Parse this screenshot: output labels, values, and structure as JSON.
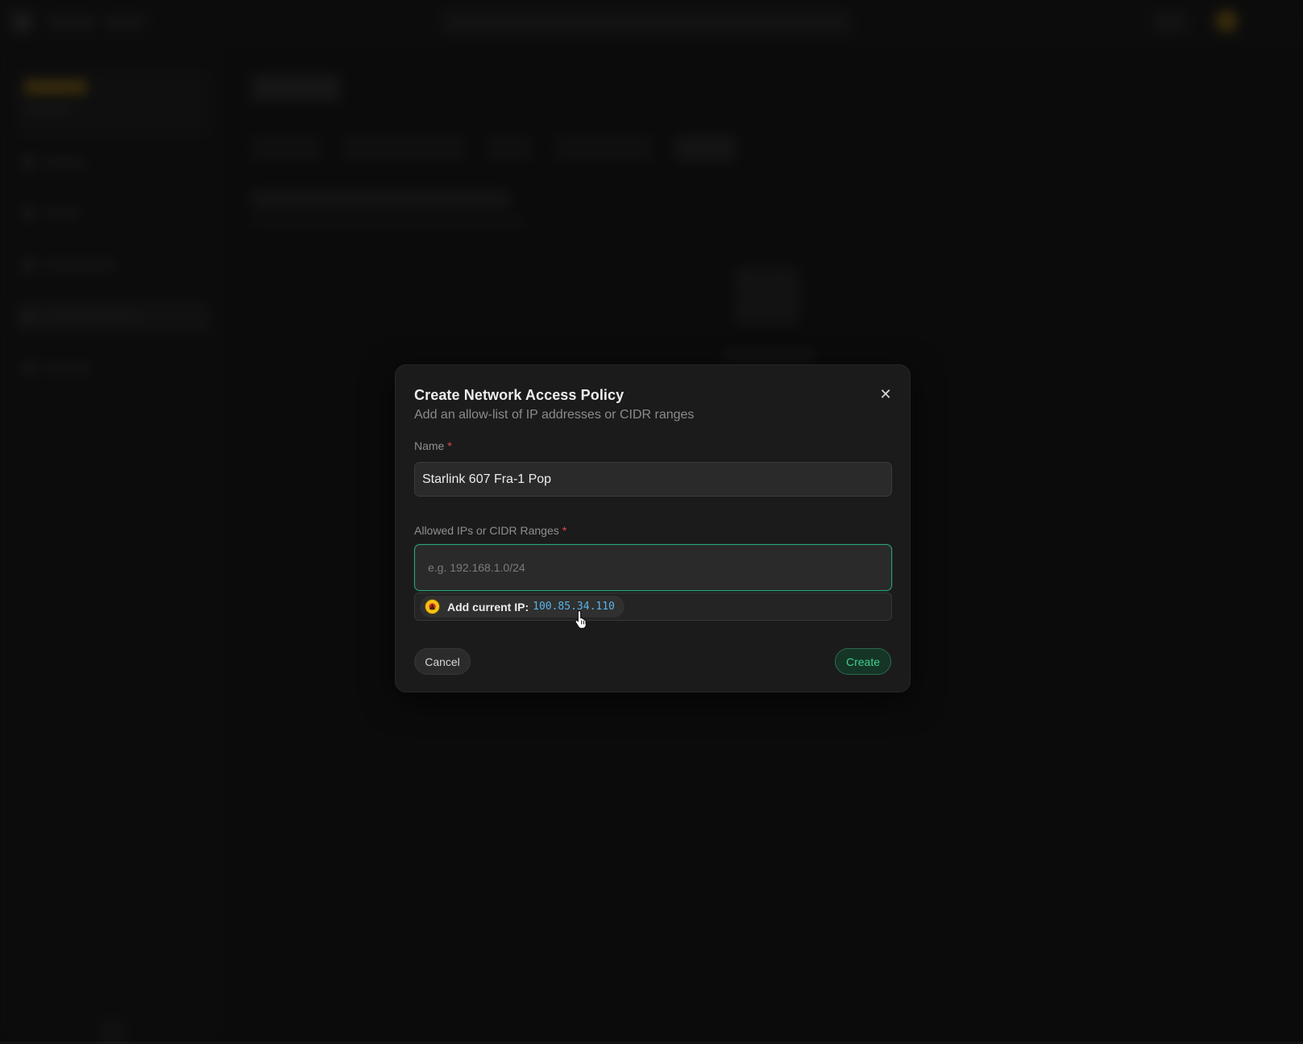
{
  "modal": {
    "title": "Create Network Access Policy",
    "description": "Add an allow-list of IP addresses or CIDR ranges",
    "close_icon": "close-icon",
    "name_field": {
      "label": "Name",
      "required_mark": "*",
      "value": "Starlink 607 Fra-1 Pop"
    },
    "ips_field": {
      "label": "Allowed IPs or CIDR Ranges",
      "required_mark": "*",
      "value": "",
      "placeholder": "e.g. 192.168.1.0/24"
    },
    "suggestion": {
      "label": "Add current IP:",
      "ip": "100.85.34.110",
      "icon": "flag-icon"
    },
    "cancel_label": "Cancel",
    "create_label": "Create"
  },
  "colors": {
    "accent": "#3ecf8e",
    "focus_border": "#27a47a",
    "required": "#e5484d",
    "ip_text": "#58b4e8",
    "background": "#121212",
    "modal_background": "#1b1b1b"
  }
}
